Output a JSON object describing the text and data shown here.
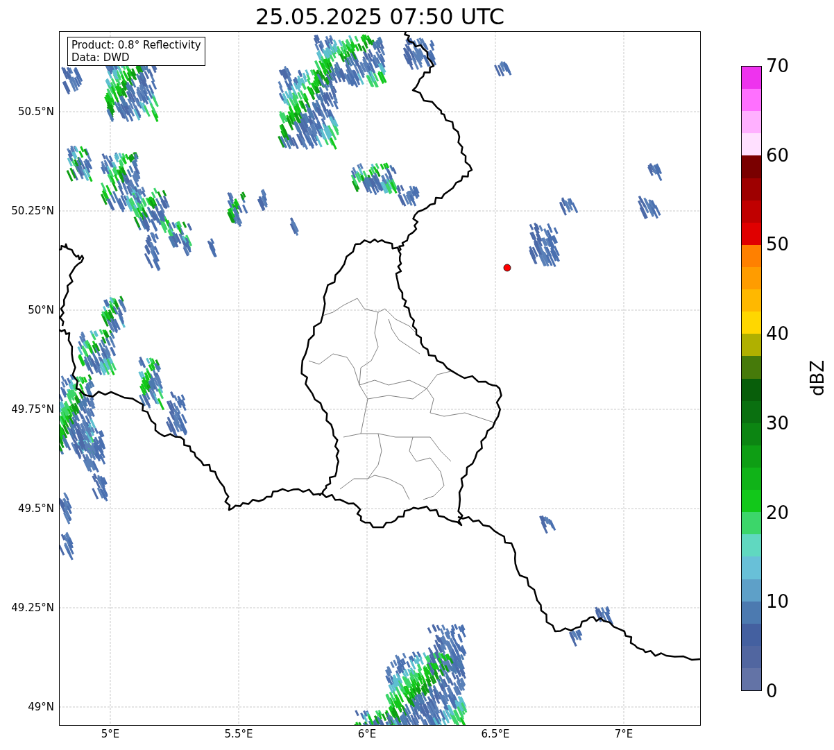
{
  "title": "25.05.2025 07:50 UTC",
  "info_box": [
    "Product: 0.8° Reflectivity",
    "Data: DWD"
  ],
  "lat_ticks": [
    "50.5°N",
    "50.25°N",
    "50°N",
    "49.75°N",
    "49.5°N",
    "49.25°N",
    "49°N"
  ],
  "lon_ticks": [
    "5°E",
    "5.5°E",
    "6°E",
    "6.5°E",
    "7°E"
  ],
  "colorbar": {
    "label": "dBZ",
    "ticks": [
      "70",
      "60",
      "50",
      "40",
      "30",
      "20",
      "10",
      "0"
    ],
    "bands": [
      {
        "color": "#ee33ee"
      },
      {
        "color": "#ff70ff"
      },
      {
        "color": "#ffb0ff"
      },
      {
        "color": "#ffe0ff"
      },
      {
        "color": "#7a0000"
      },
      {
        "color": "#9e0000"
      },
      {
        "color": "#c00000"
      },
      {
        "color": "#e00000"
      },
      {
        "color": "#ff8000"
      },
      {
        "color": "#ff9c00"
      },
      {
        "color": "#ffb800"
      },
      {
        "color": "#ffd700"
      },
      {
        "color": "#b0b000"
      },
      {
        "color": "#467a0a"
      },
      {
        "color": "#085e0a"
      },
      {
        "color": "#0a7010"
      },
      {
        "color": "#0c8512"
      },
      {
        "color": "#0e9e14"
      },
      {
        "color": "#10b318"
      },
      {
        "color": "#12c81a"
      },
      {
        "color": "#3cd66a"
      },
      {
        "color": "#60d8c0"
      },
      {
        "color": "#68c0d8"
      },
      {
        "color": "#5ea0c8"
      },
      {
        "color": "#4c7ab0"
      },
      {
        "color": "#4460a0"
      },
      {
        "color": "#5166a0"
      },
      {
        "color": "#6373a6"
      }
    ]
  }
}
